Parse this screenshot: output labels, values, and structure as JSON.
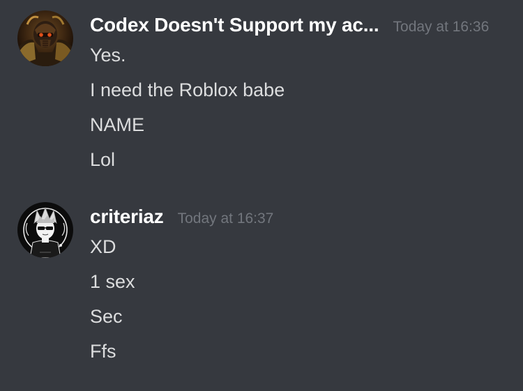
{
  "messages": [
    {
      "username": "Codex Doesn't Support my ac...",
      "timestamp": "Today at 16:36",
      "avatar_icon": "warhammer-armored-warrior-avatar",
      "lines": [
        "Yes.",
        "I need the Roblox babe",
        "NAME",
        "Lol"
      ]
    },
    {
      "username": "criteriaz",
      "timestamp": "Today at 16:37",
      "avatar_icon": "anime-sunglasses-character-avatar",
      "lines": [
        "XD",
        "1 sex",
        "Sec",
        "Ffs"
      ]
    }
  ],
  "colors": {
    "background": "#36393f",
    "username": "#ffffff",
    "timestamp": "#72767d",
    "message_text": "#dcddde"
  }
}
